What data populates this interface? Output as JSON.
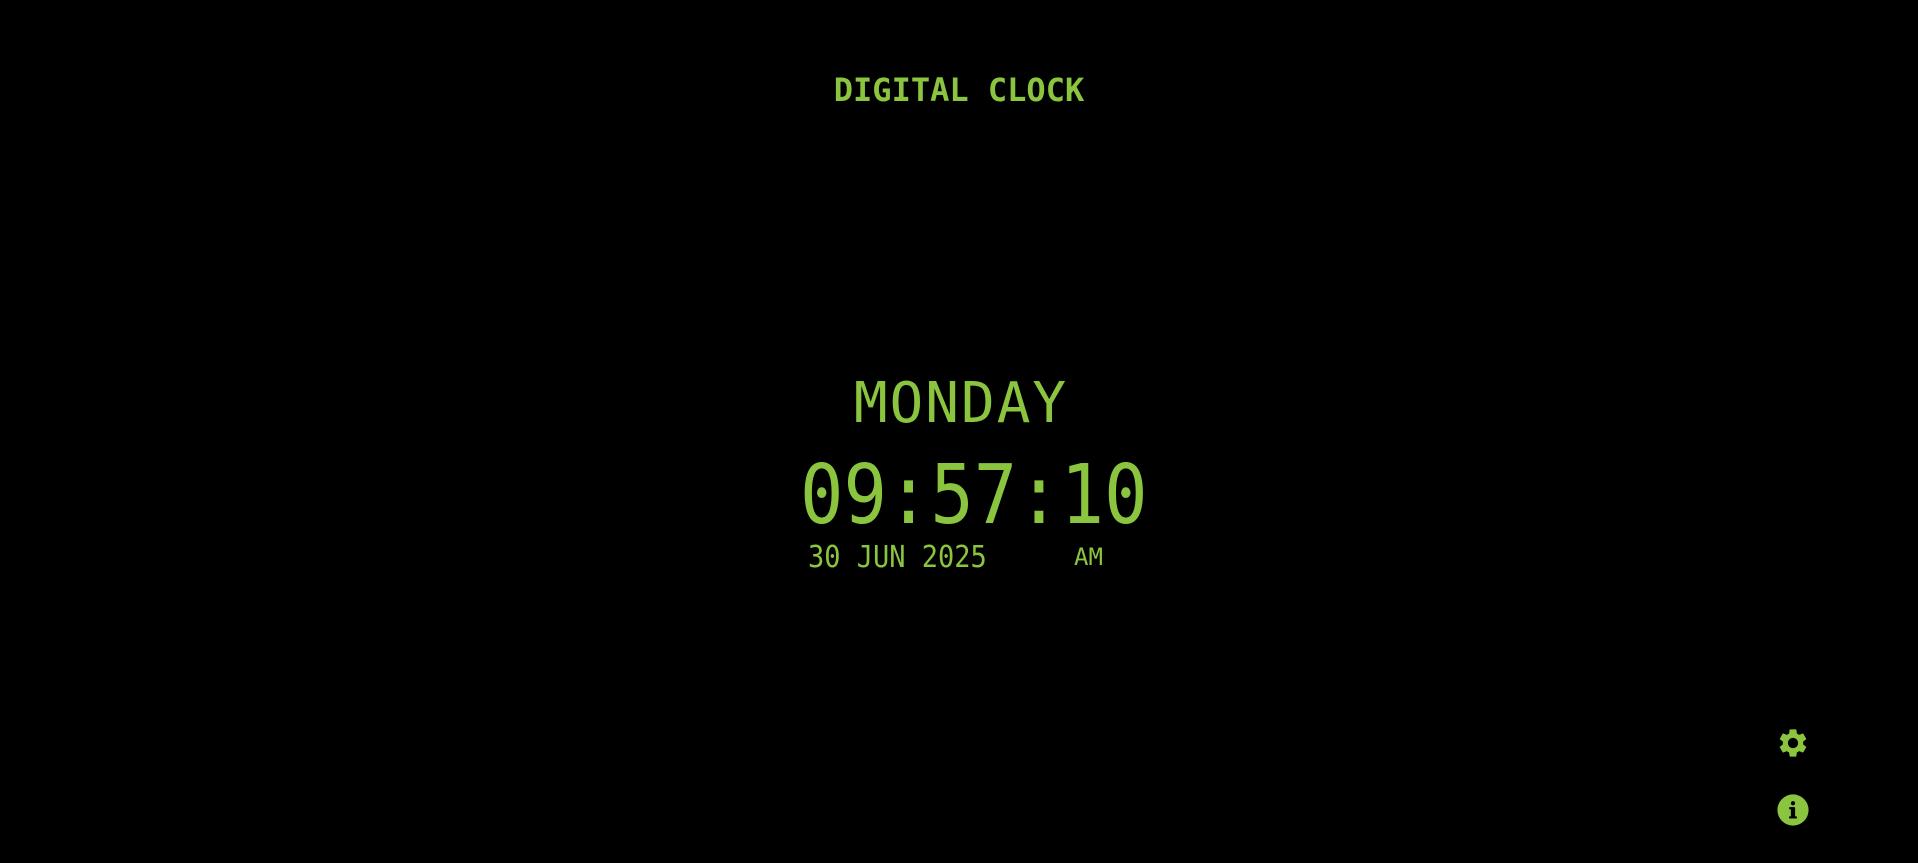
{
  "app": {
    "title": "DIGITAL CLOCK"
  },
  "clock": {
    "day": "MONDAY",
    "time": "09:57:10",
    "date": "30 JUN 2025",
    "period": "AM"
  },
  "controls": {
    "settings_icon": "gear-icon",
    "info_icon": "info-icon"
  },
  "colors": {
    "background": "#000000",
    "accent": "#8BC53F"
  }
}
